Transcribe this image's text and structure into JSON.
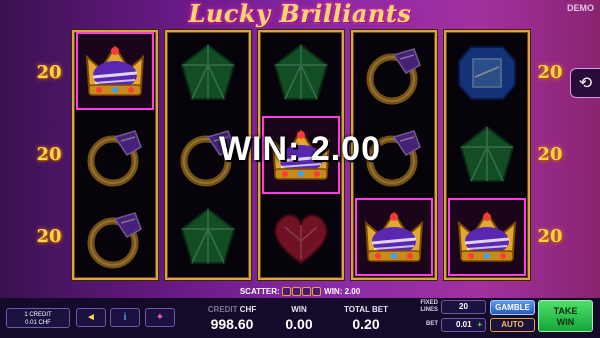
{
  "header": {
    "title": "Lucky Brilliants",
    "mode": "DEMO"
  },
  "lines": {
    "left": [
      "20",
      "20",
      "20"
    ],
    "right": [
      "20",
      "20",
      "20"
    ]
  },
  "reels": [
    [
      "crown",
      "ring",
      "ring"
    ],
    [
      "emerald",
      "ring",
      "emerald"
    ],
    [
      "emerald",
      "crown",
      "heart"
    ],
    [
      "ring",
      "ring",
      "crown"
    ],
    [
      "sapphire",
      "emerald",
      "crown"
    ]
  ],
  "highlighted": [
    "crown"
  ],
  "win_banner": "WIN: 2.00",
  "scatter_bar": {
    "label": "SCATTER:",
    "win": "WIN: 2.00"
  },
  "bottom": {
    "credit_info": {
      "line1": "1 CREDIT",
      "line2": "0.01 CHF"
    },
    "credit": {
      "label_dim": "CREDIT",
      "label": "CHF",
      "value": "998.60"
    },
    "win": {
      "label": "WIN",
      "value": "0.00"
    },
    "total_bet": {
      "label": "TOTAL BET",
      "value": "0.20"
    },
    "fixed_lines": {
      "label1": "FIXED",
      "label2": "LINES",
      "value": "20"
    },
    "bet": {
      "label": "BET",
      "value": "0.01",
      "plus": "+"
    },
    "gamble": "GAMBLE",
    "auto": "AUTO",
    "take_win": {
      "line1": "TAKE",
      "line2": "WIN"
    }
  },
  "icons": {
    "history": "history-icon",
    "sound": "speaker-icon",
    "info": "info-icon",
    "settings": "settings-icon"
  },
  "colors": {
    "accent_gold": "#d9a544",
    "highlight_magenta": "#ff3de8",
    "gamble_blue": "#2a5cb8",
    "take_green": "#15a43a"
  }
}
